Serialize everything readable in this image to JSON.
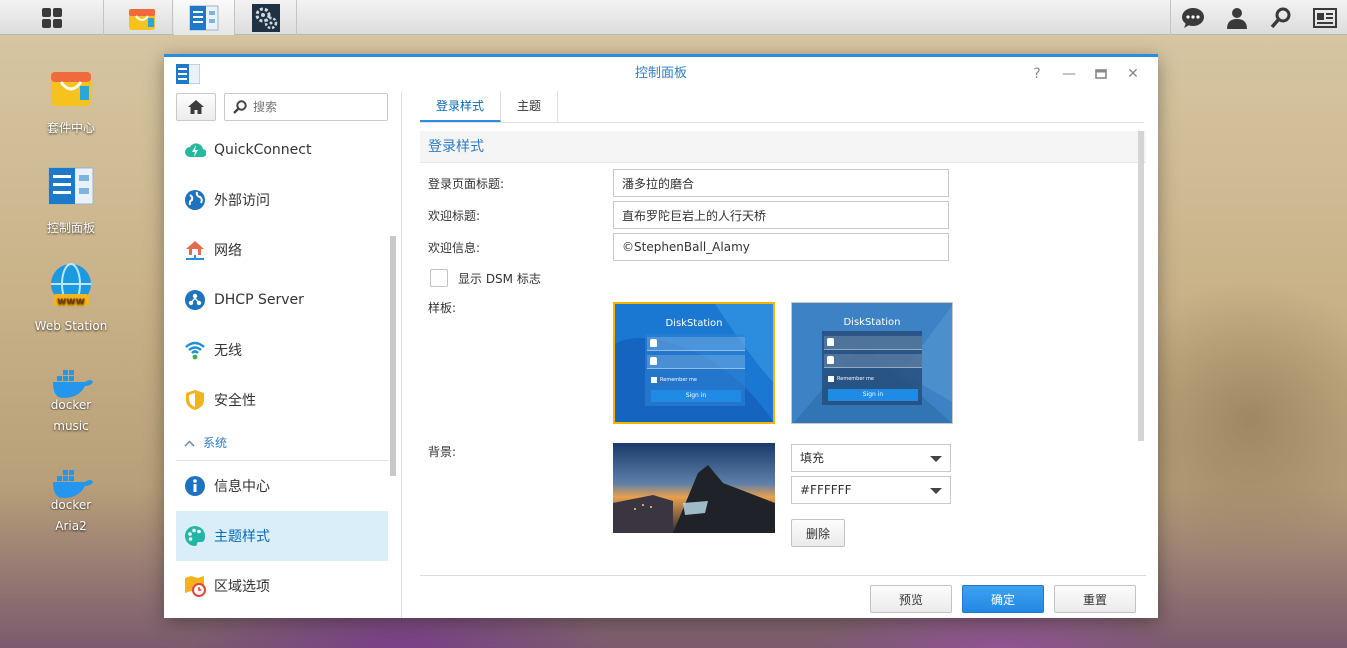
{
  "taskbar": {
    "main_menu_icon": "grid-icon",
    "open_apps": [
      {
        "icon": "package-center-icon"
      },
      {
        "icon": "control-panel-icon"
      },
      {
        "icon": "gears-icon"
      }
    ],
    "right_icons": [
      "chat-icon",
      "user-icon",
      "search-icon",
      "widgets-icon"
    ]
  },
  "desktop": {
    "icons": [
      {
        "label": "套件中心",
        "icon": "package-center-icon"
      },
      {
        "label": "控制面板",
        "icon": "control-panel-icon"
      },
      {
        "label": "Web Station",
        "icon": "web-station-icon"
      },
      {
        "label": "music",
        "icon": "docker-icon",
        "brand": "docker"
      },
      {
        "label": "Aria2",
        "icon": "docker-icon",
        "brand": "docker"
      }
    ]
  },
  "window": {
    "title": "控制面板",
    "controls": [
      "help-icon",
      "minimize-icon",
      "maximize-icon",
      "close-icon"
    ]
  },
  "sidebar": {
    "search_placeholder": "搜索",
    "items": [
      {
        "label": "QuickConnect",
        "icon": "quickconnect-icon"
      },
      {
        "label": "外部访问",
        "icon": "globe-icon"
      },
      {
        "label": "网络",
        "icon": "network-house-icon"
      },
      {
        "label": "DHCP Server",
        "icon": "dhcp-icon"
      },
      {
        "label": "无线",
        "icon": "wifi-icon"
      },
      {
        "label": "安全性",
        "icon": "shield-icon"
      }
    ],
    "section": "系统",
    "system_items": [
      {
        "label": "信息中心",
        "icon": "info-icon"
      },
      {
        "label": "主题样式",
        "icon": "palette-icon",
        "selected": true
      },
      {
        "label": "区域选项",
        "icon": "region-icon"
      }
    ]
  },
  "tabs": [
    {
      "label": "登录样式",
      "active": true
    },
    {
      "label": "主题",
      "active": false
    }
  ],
  "form": {
    "section_title": "登录样式",
    "login_title_label": "登录页面标题:",
    "login_title_value": "潘多拉的磨合",
    "welcome_title_label": "欢迎标题:",
    "welcome_title_value": "直布罗陀巨岩上的人行天桥",
    "welcome_msg_label": "欢迎信息:",
    "welcome_msg_value": "©StephenBall_Alamy",
    "show_dsm_logo_label": "显示 DSM 标志",
    "show_dsm_logo_checked": false,
    "template_label": "样板:",
    "templates": [
      {
        "name": "DiskStation",
        "remember": "Remember me",
        "signin": "Sign in",
        "selected": true
      },
      {
        "name": "DiskStation",
        "remember": "Remember me",
        "signin": "Sign in",
        "selected": false
      }
    ],
    "background_label": "背景:",
    "fill_mode": "填充",
    "bg_color": "#FFFFFF",
    "delete_label": "删除"
  },
  "footer": {
    "preview": "预览",
    "ok": "确定",
    "reset": "重置"
  },
  "colors": {
    "accent": "#2a8ee0",
    "selected_template_border": "#f4b400",
    "sidebar_selected_bg": "#daeefa"
  }
}
